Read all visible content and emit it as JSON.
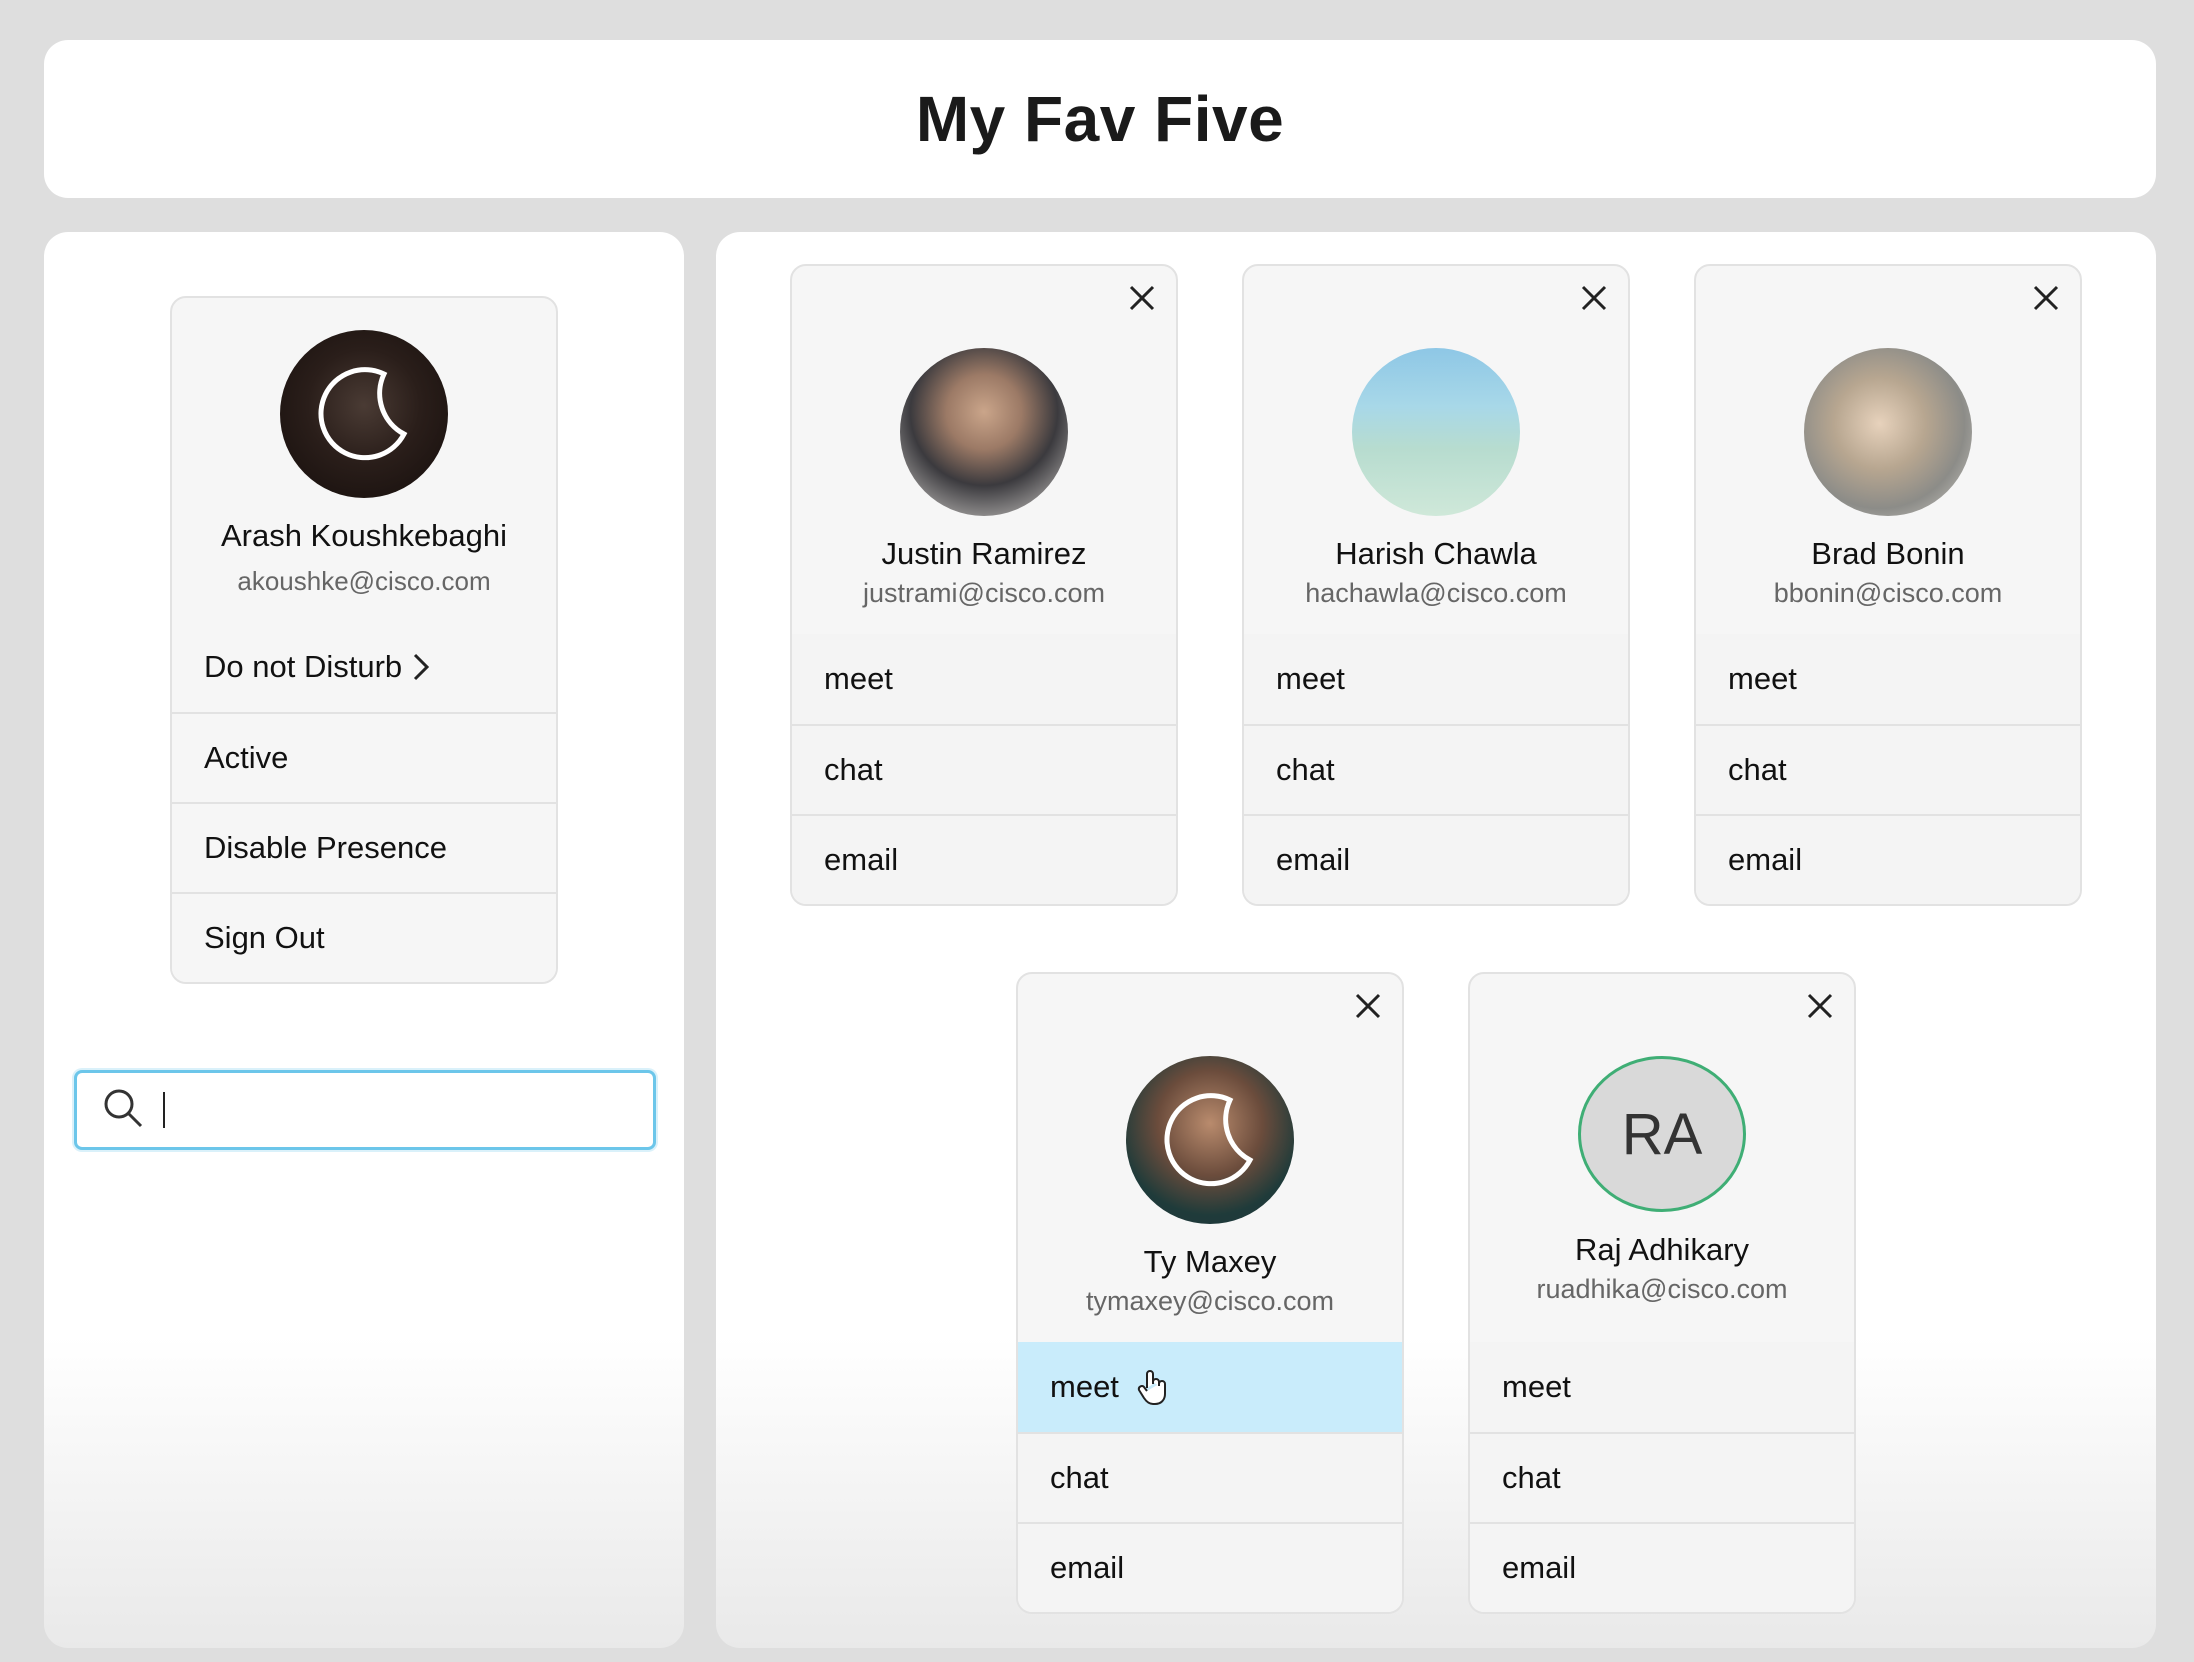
{
  "app": {
    "title": "My Fav Five"
  },
  "profile": {
    "name": "Arash Koushkebaghi",
    "email": "akoushke@cisco.com",
    "status_icon": "moon-dnd-icon",
    "menu": [
      {
        "label": "Do not Disturb",
        "icon": "chevron-right-icon"
      },
      {
        "label": "Active"
      },
      {
        "label": "Disable Presence"
      },
      {
        "label": "Sign Out"
      }
    ]
  },
  "search": {
    "value": "",
    "placeholder": "",
    "icon": "search-icon"
  },
  "contacts": [
    {
      "name": "Justin Ramirez",
      "email": "justrami@cisco.com",
      "avatar": "photo",
      "actions": [
        "meet",
        "chat",
        "email"
      ]
    },
    {
      "name": "Harish Chawla",
      "email": "hachawla@cisco.com",
      "avatar": "photo",
      "actions": [
        "meet",
        "chat",
        "email"
      ]
    },
    {
      "name": "Brad Bonin",
      "email": "bbonin@cisco.com",
      "avatar": "photo",
      "actions": [
        "meet",
        "chat",
        "email"
      ]
    },
    {
      "name": "Ty Maxey",
      "email": "tymaxey@cisco.com",
      "avatar": "photo",
      "status_icon": "moon-dnd-icon",
      "hovered_action": "meet",
      "actions": [
        "meet",
        "chat",
        "email"
      ]
    },
    {
      "name": "Raj Adhikary",
      "email": "ruadhika@cisco.com",
      "avatar": "initials",
      "initials": "RA",
      "actions": [
        "meet",
        "chat",
        "email"
      ]
    }
  ],
  "colors": {
    "hover_row": "#c9ecfb",
    "search_focus": "#6cc6ea",
    "initials_ring": "#3fae75"
  }
}
